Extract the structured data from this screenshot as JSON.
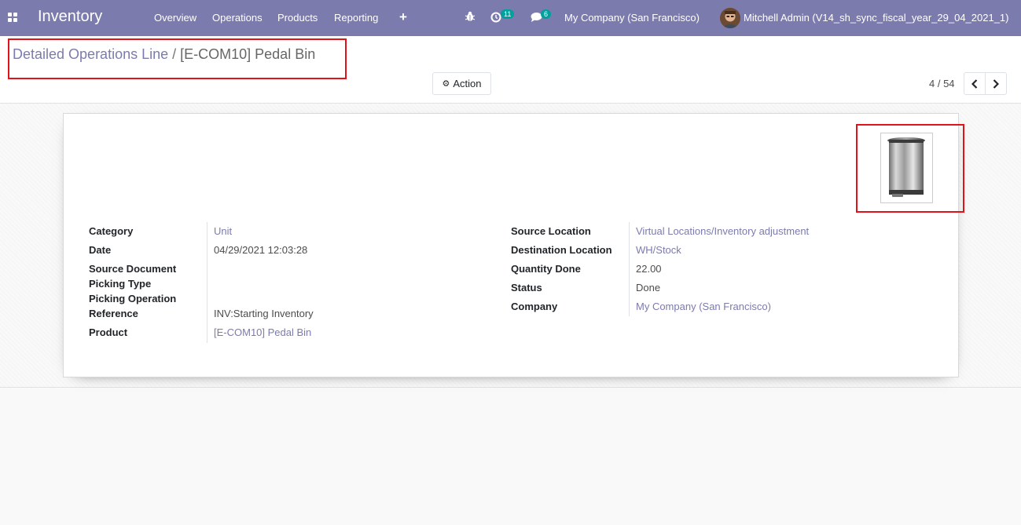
{
  "navbar": {
    "brand": "Inventory",
    "menu": [
      "Overview",
      "Operations",
      "Products",
      "Reporting"
    ],
    "activity_count": "11",
    "message_count": "6",
    "company": "My Company (San Francisco)",
    "user": "Mitchell Admin (V14_sh_sync_fiscal_year_29_04_2021_1)"
  },
  "breadcrumb": {
    "parent": "Detailed Operations Line",
    "separator": "/",
    "current": "[E-COM10] Pedal Bin"
  },
  "toolbar": {
    "action_label": "Action",
    "pager_value": "4 / 54"
  },
  "form": {
    "left": {
      "category_label": "Category",
      "category_value": "Unit",
      "date_label": "Date",
      "date_value": "04/29/2021 12:03:28",
      "source_document_label": "Source Document",
      "picking_type_label": "Picking Type",
      "picking_operation_label": "Picking Operation",
      "reference_label": "Reference",
      "reference_value": "INV:Starting Inventory",
      "product_label": "Product",
      "product_value": "[E-COM10] Pedal Bin"
    },
    "right": {
      "source_location_label": "Source Location",
      "source_location_value": "Virtual Locations/Inventory adjustment",
      "destination_location_label": "Destination Location",
      "destination_location_value": "WH/Stock",
      "quantity_done_label": "Quantity Done",
      "quantity_done_value": "22.00",
      "status_label": "Status",
      "status_value": "Done",
      "company_label": "Company",
      "company_value": "My Company (San Francisco)"
    }
  },
  "colors": {
    "navbar": "#7c7bad",
    "link": "#7c7bad",
    "highlight": "#e0131a",
    "badge": "#00a09d"
  },
  "icons": {
    "apps": "apps-grid-icon",
    "plus": "plus-icon",
    "bug": "bug-icon",
    "activity": "clock-icon",
    "messages": "chat-icon",
    "action": "gear-icon",
    "pager_prev": "chevron-left-icon",
    "pager_next": "chevron-right-icon",
    "product_image": "pedal-bin-image"
  }
}
